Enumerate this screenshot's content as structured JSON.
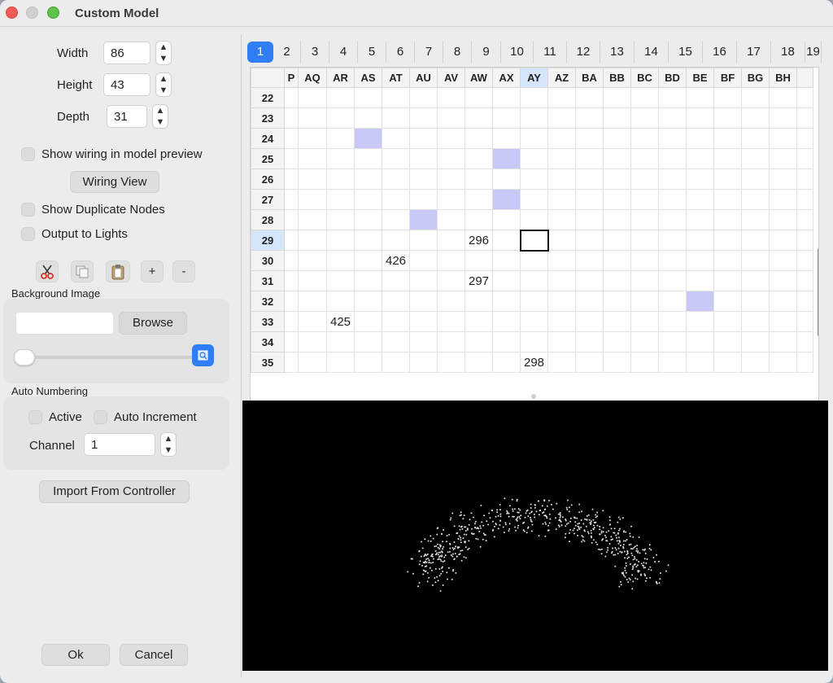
{
  "window": {
    "title": "Custom Model"
  },
  "dims": {
    "width_label": "Width",
    "width_value": "86",
    "height_label": "Height",
    "height_value": "43",
    "depth_label": "Depth",
    "depth_value": "31"
  },
  "options": {
    "show_wiring_label": "Show wiring in model preview",
    "wiring_view_button": "Wiring View",
    "show_duplicate_label": "Show Duplicate Nodes",
    "output_to_lights_label": "Output to Lights"
  },
  "toolbar": {
    "cut_icon": "scissors-icon",
    "copy_icon": "copy-icon",
    "paste_icon": "clipboard-icon",
    "plus_label": "+",
    "minus_label": "-"
  },
  "background": {
    "section_label": "Background Image",
    "browse_button": "Browse",
    "slider_value": 0
  },
  "auto_numbering": {
    "section_label": "Auto Numbering",
    "active_label": "Active",
    "auto_increment_label": "Auto Increment",
    "channel_label": "Channel",
    "channel_value": "1"
  },
  "import_button": "Import From Controller",
  "ok_button": "Ok",
  "cancel_button": "Cancel",
  "tabs": [
    "1",
    "2",
    "3",
    "4",
    "5",
    "6",
    "7",
    "8",
    "9",
    "10",
    "11",
    "12",
    "13",
    "14",
    "15",
    "16",
    "17",
    "18",
    "19"
  ],
  "active_tab": "1",
  "grid": {
    "columns": [
      "P",
      "AQ",
      "AR",
      "AS",
      "AT",
      "AU",
      "AV",
      "AW",
      "AX",
      "AY",
      "AZ",
      "BA",
      "BB",
      "BC",
      "BD",
      "BE",
      "BF",
      "BG",
      "BH",
      ""
    ],
    "selected_column": "AY",
    "selected_row": "29",
    "rows": [
      {
        "n": "22",
        "cells": {}
      },
      {
        "n": "23",
        "cells": {}
      },
      {
        "n": "24",
        "cells": {}
      },
      {
        "n": "25",
        "cells": {}
      },
      {
        "n": "26",
        "cells": {}
      },
      {
        "n": "27",
        "cells": {}
      },
      {
        "n": "28",
        "cells": {}
      },
      {
        "n": "29",
        "cells": {
          "AW": "296"
        }
      },
      {
        "n": "30",
        "cells": {
          "AT": "426"
        }
      },
      {
        "n": "31",
        "cells": {
          "AW": "297"
        }
      },
      {
        "n": "32",
        "cells": {}
      },
      {
        "n": "33",
        "cells": {
          "AR": "425"
        }
      },
      {
        "n": "34",
        "cells": {}
      },
      {
        "n": "35",
        "cells": {
          "AY": "298"
        }
      }
    ],
    "highlighted": [
      [
        "24",
        "AS"
      ],
      [
        "25",
        "AX"
      ],
      [
        "27",
        "AX"
      ],
      [
        "28",
        "AU"
      ],
      [
        "32",
        "BE"
      ]
    ],
    "cursor": [
      "29",
      "AY"
    ]
  },
  "colors": {
    "accent": "#2f7ef5",
    "highlight": "#c9c9f7",
    "selection": "#d5e5fb",
    "preview_bg": "#000000"
  }
}
